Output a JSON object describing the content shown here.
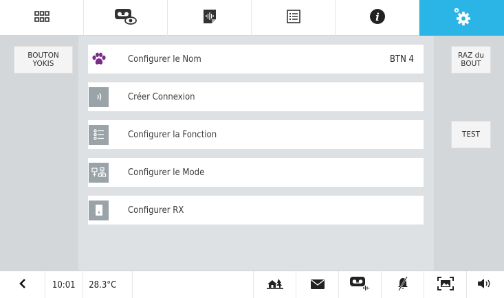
{
  "top_tabs": [
    {
      "icon": "grid-icon"
    },
    {
      "icon": "voicemail-eye-icon"
    },
    {
      "icon": "audio-file-icon"
    },
    {
      "icon": "list-icon"
    },
    {
      "icon": "info-icon"
    },
    {
      "icon": "settings-gear-icon",
      "active": true
    }
  ],
  "left": {
    "button_label": "BOUTON\nYOKIS"
  },
  "right": {
    "reset_label": "RAZ du\nBOUT",
    "test_label": "TEST"
  },
  "rows": [
    {
      "icon": "paw-icon",
      "label": "Configurer le Nom",
      "value": "BTN 4"
    },
    {
      "icon": "signal-waves-icon",
      "label": "Créer Connexion"
    },
    {
      "icon": "function-list-icon",
      "label": "Configurer la Fonction"
    },
    {
      "icon": "mode-network-icon",
      "label": "Configurer le Mode"
    },
    {
      "icon": "rx-module-icon",
      "label": "Configurer RX"
    }
  ],
  "bottom": {
    "time": "10:01",
    "temperature": "28.3°C",
    "icons": [
      "back-arrow-icon",
      "home-icon",
      "mail-icon",
      "voicemail-audio-icon",
      "mute-icon",
      "screen-image-icon",
      "speaker-icon"
    ]
  },
  "colors": {
    "accent": "#2bb5e6",
    "paw": "#7a2d87",
    "icon_bg": "#9aa3a8"
  }
}
